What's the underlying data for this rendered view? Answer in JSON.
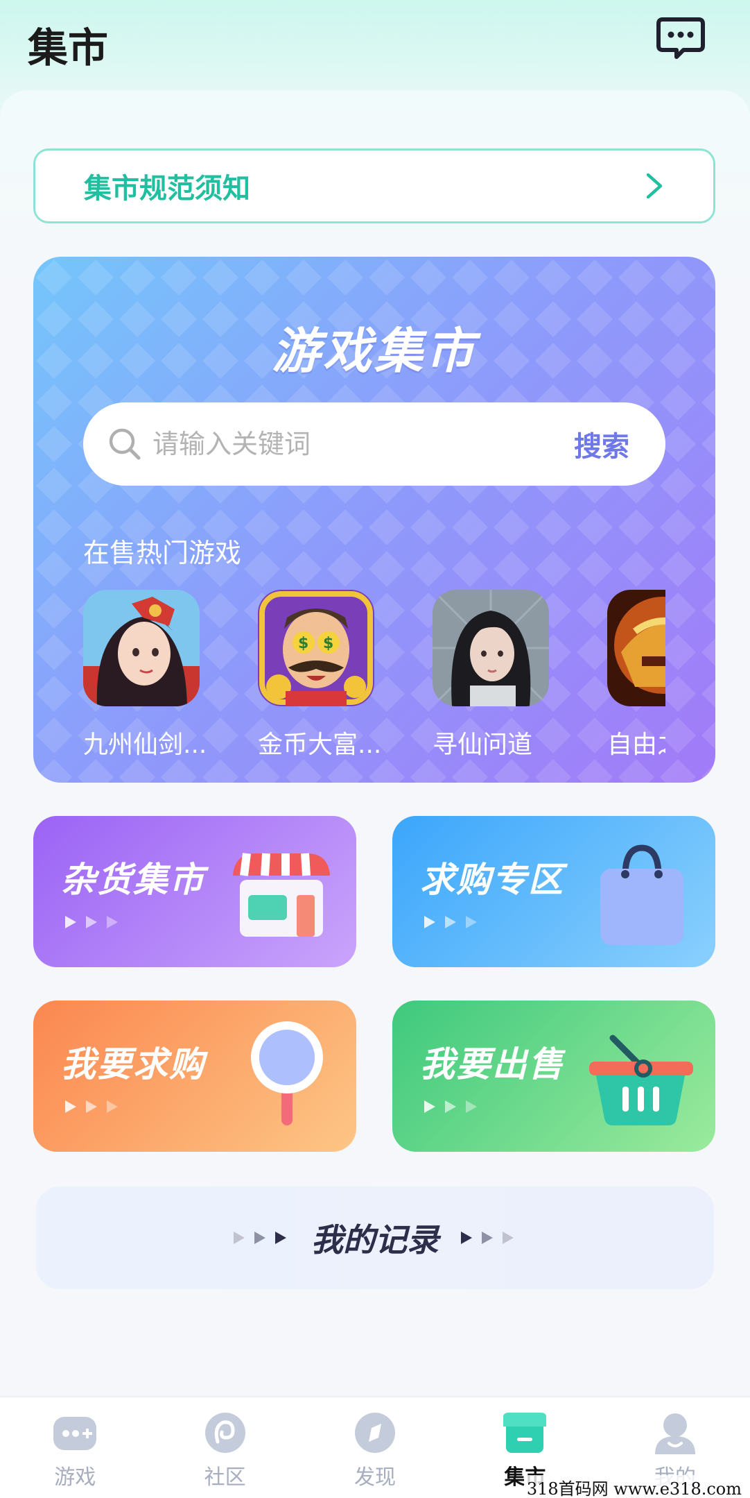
{
  "header": {
    "title": "集市"
  },
  "rules_banner": {
    "label": "集市规范须知"
  },
  "market": {
    "title": "游戏集市",
    "search_placeholder": "请输入关键词",
    "search_button": "搜索",
    "hot_label": "在售热门游戏",
    "games": [
      {
        "name": "九州仙剑...",
        "icon": "game-icon-red-hair-heroine"
      },
      {
        "name": "金币大富...",
        "icon": "game-icon-money-mustache-man"
      },
      {
        "name": "寻仙问道",
        "icon": "game-icon-black-hair-girl"
      },
      {
        "name": "自由之",
        "icon": "game-icon-golden-armor"
      }
    ]
  },
  "tiles": {
    "grocery": {
      "title": "杂货集市",
      "icon": "store-icon",
      "gradient": [
        "#9b63f5",
        "#c9a4fb"
      ]
    },
    "wanted": {
      "title": "求购专区",
      "icon": "shopping-bag-icon",
      "gradient": [
        "#3ba6fb",
        "#8ad0fd"
      ]
    },
    "buy": {
      "title": "我要求购",
      "icon": "magnifier-icon",
      "gradient": [
        "#fb8750",
        "#fdc685"
      ]
    },
    "sell": {
      "title": "我要出售",
      "icon": "basket-icon",
      "gradient": [
        "#3ec97d",
        "#9bea9c"
      ]
    }
  },
  "records": {
    "label": "我的记录"
  },
  "tabs": [
    {
      "label": "游戏",
      "icon": "gamepad-icon"
    },
    {
      "label": "社区",
      "icon": "community-icon"
    },
    {
      "label": "发现",
      "icon": "compass-icon"
    },
    {
      "label": "集市",
      "icon": "market-icon",
      "active": true
    },
    {
      "label": "我的",
      "icon": "profile-icon"
    }
  ],
  "watermark": "318首码网  www.e318.com",
  "colors": {
    "accent_teal": "#1fbfa0",
    "search_button": "#6e78e8",
    "tab_inactive": "#a7aec0"
  }
}
